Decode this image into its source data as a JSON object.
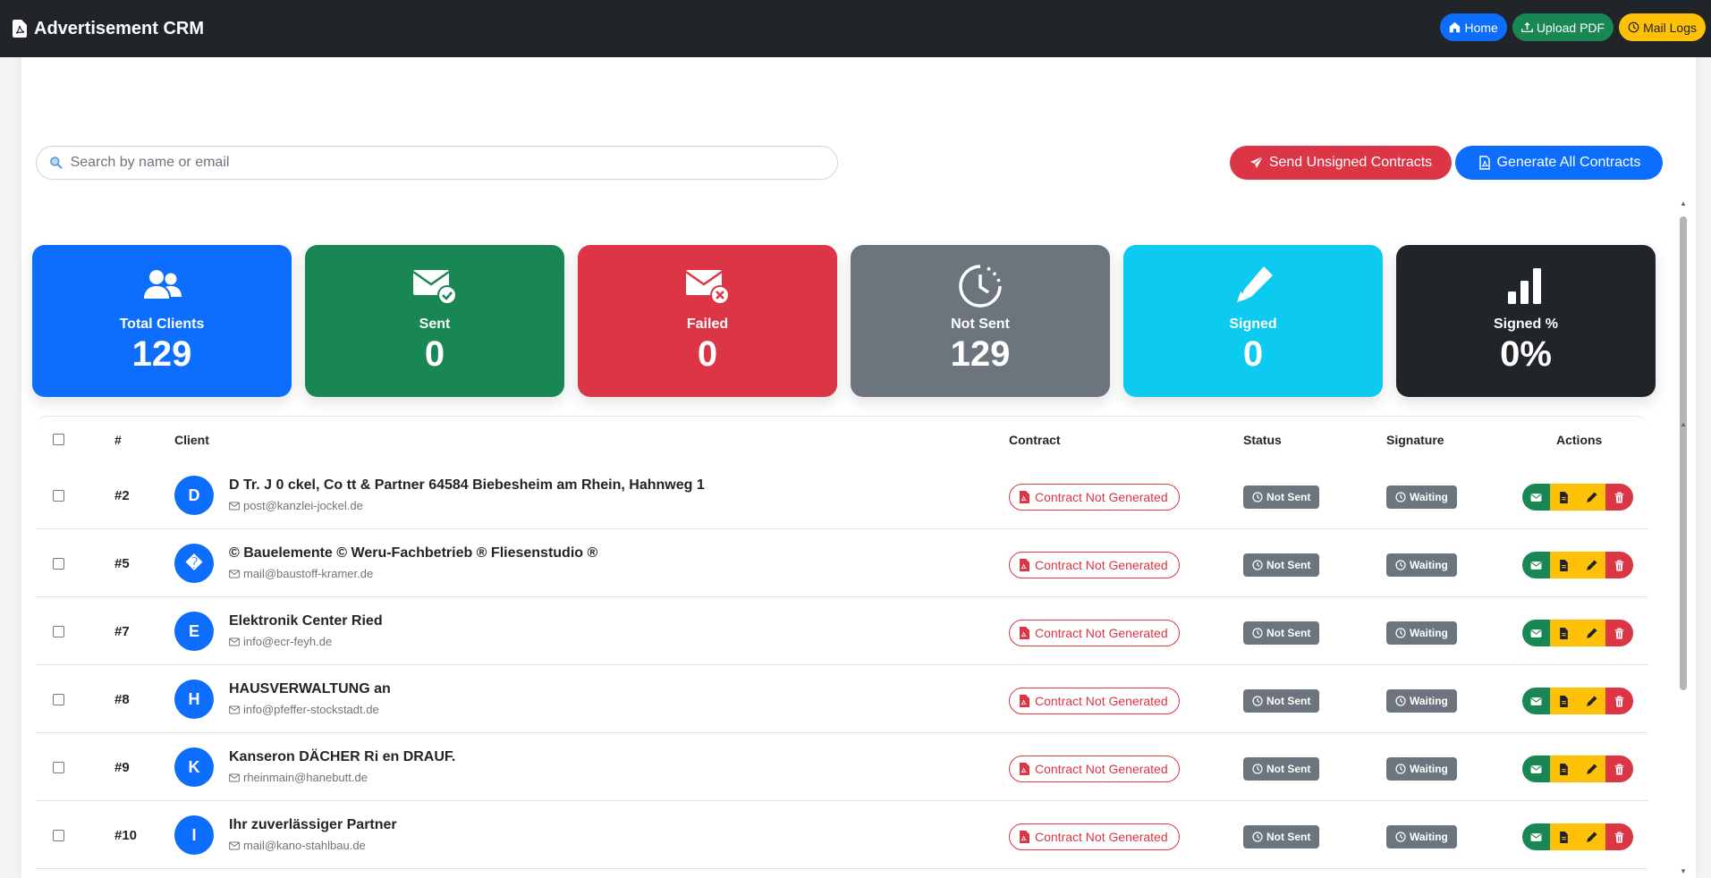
{
  "navbar": {
    "brand": "Advertisement CRM",
    "buttons": {
      "home": "Home",
      "upload": "Upload PDF",
      "logs": "Mail Logs"
    }
  },
  "toolbar": {
    "search_placeholder": "Search by name or email",
    "send_label": "Send Unsigned Contracts",
    "generate_label": "Generate All Contracts"
  },
  "stats": [
    {
      "label": "Total Clients",
      "value": "129",
      "color": "#0d6efd",
      "icon": "users-icon"
    },
    {
      "label": "Sent",
      "value": "0",
      "color": "#198754",
      "icon": "envelope-check-icon"
    },
    {
      "label": "Failed",
      "value": "0",
      "color": "#dc3545",
      "icon": "envelope-x-icon"
    },
    {
      "label": "Not Sent",
      "value": "129",
      "color": "#6c757d",
      "icon": "clock-icon"
    },
    {
      "label": "Signed",
      "value": "0",
      "color": "#0dcaf0",
      "icon": "pen-icon"
    },
    {
      "label": "Signed %",
      "value": "0%",
      "color": "#212529",
      "icon": "bar-chart-icon"
    }
  ],
  "table": {
    "headers": {
      "num": "#",
      "client": "Client",
      "contract": "Contract",
      "status": "Status",
      "signature": "Signature",
      "actions": "Actions"
    },
    "rows": [
      {
        "num": "#2",
        "initial": "D",
        "name": "D Tr. J 0 ckel, Co tt & Partner 64584 Biebesheim am Rhein, Hahnweg 1",
        "email": "post@kanzlei-jockel.de",
        "contract": "Contract Not Generated",
        "status": "Not Sent",
        "signature": "Waiting"
      },
      {
        "num": "#5",
        "initial": "�",
        "name": "© Bauelemente © Weru-Fachbetrieb ® Fliesenstudio ®",
        "email": "mail@baustoff-kramer.de",
        "contract": "Contract Not Generated",
        "status": "Not Sent",
        "signature": "Waiting"
      },
      {
        "num": "#7",
        "initial": "E",
        "name": "Elektronik Center Ried",
        "email": "info@ecr-feyh.de",
        "contract": "Contract Not Generated",
        "status": "Not Sent",
        "signature": "Waiting"
      },
      {
        "num": "#8",
        "initial": "H",
        "name": "HAUSVERWALTUNG an",
        "email": "info@pfeffer-stockstadt.de",
        "contract": "Contract Not Generated",
        "status": "Not Sent",
        "signature": "Waiting"
      },
      {
        "num": "#9",
        "initial": "K",
        "name": "Kanseron DÄCHER Ri en DRAUF.",
        "email": "rheinmain@hanebutt.de",
        "contract": "Contract Not Generated",
        "status": "Not Sent",
        "signature": "Waiting"
      },
      {
        "num": "#10",
        "initial": "I",
        "name": "Ihr zuverlässiger Partner",
        "email": "mail@kano-stahlbau.de",
        "contract": "Contract Not Generated",
        "status": "Not Sent",
        "signature": "Waiting"
      }
    ]
  }
}
